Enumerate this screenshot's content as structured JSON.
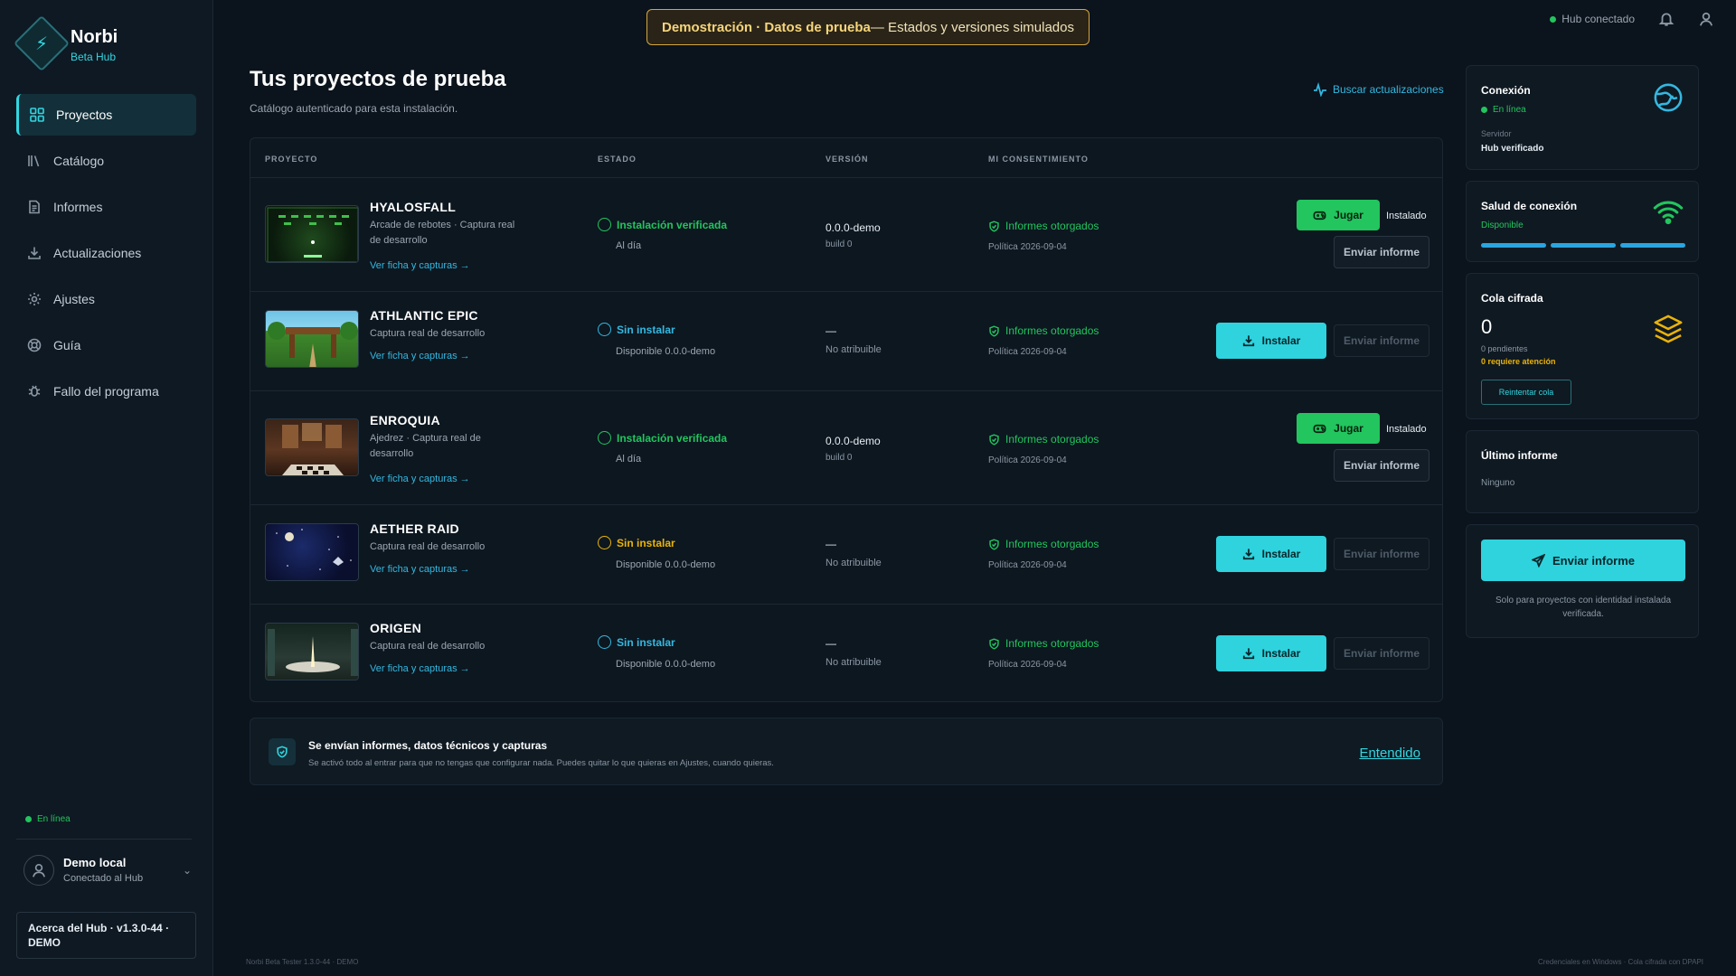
{
  "brand": {
    "name": "Norbi",
    "sub": "Beta Hub"
  },
  "nav": [
    {
      "label": "Proyectos",
      "icon": "grid-icon",
      "active": true
    },
    {
      "label": "Catálogo",
      "icon": "library-icon"
    },
    {
      "label": "Informes",
      "icon": "document-icon"
    },
    {
      "label": "Actualizaciones",
      "icon": "download-icon"
    },
    {
      "label": "Ajustes",
      "icon": "gear-icon"
    },
    {
      "label": "Guía",
      "icon": "lifebuoy-icon"
    },
    {
      "label": "Fallo del programa",
      "icon": "bug-icon"
    }
  ],
  "sidebar_status": "En línea",
  "user": {
    "name": "Demo local",
    "sub": "Conectado al Hub"
  },
  "about": "Acerca del Hub · v1.3.0-44 · DEMO",
  "banner": {
    "bold": "Demostración · Datos de prueba",
    "rest": " — Estados y versiones simulados"
  },
  "topbar": {
    "hub_status": "Hub conectado"
  },
  "page": {
    "title": "Tus proyectos de prueba",
    "subtitle": "Catálogo autenticado para esta instalación.",
    "check_updates": "Buscar actualizaciones"
  },
  "table": {
    "headers": {
      "project": "PROYECTO",
      "state": "ESTADO",
      "version": "VERSIÓN",
      "consent": "MI CONSENTIMIENTO"
    },
    "rows": [
      {
        "name": "HYALOSFALL",
        "desc": "Arcade de rebotes · Captura real de desarrollo",
        "link": "Ver ficha y capturas →",
        "state": "Instalación verificada",
        "state_sub": "Al día",
        "state_color": "#22c55e",
        "version": "0.0.0-demo",
        "version_sub": "build 0",
        "consent": "Informes otorgados",
        "consent_sub": "Política 2026-09-04",
        "installed": true,
        "play": "Jugar",
        "installed_label": "Instalado",
        "report": "Enviar informe"
      },
      {
        "name": "ATHLANTIC EPIC",
        "desc": "Captura real de desarrollo",
        "link": "Ver ficha y capturas →",
        "state": "Sin instalar",
        "state_sub": "Disponible 0.0.0-demo",
        "state_color": "#33b8e0",
        "version": "—",
        "version_sub": "No atribuible",
        "consent": "Informes otorgados",
        "consent_sub": "Política 2026-09-04",
        "installed": false,
        "install": "Instalar",
        "report": "Enviar informe"
      },
      {
        "name": "ENROQUIA",
        "desc": "Ajedrez · Captura real de desarrollo",
        "link": "Ver ficha y capturas →",
        "state": "Instalación verificada",
        "state_sub": "Al día",
        "state_color": "#22c55e",
        "version": "0.0.0-demo",
        "version_sub": "build 0",
        "consent": "Informes otorgados",
        "consent_sub": "Política 2026-09-04",
        "installed": true,
        "play": "Jugar",
        "installed_label": "Instalado",
        "report": "Enviar informe"
      },
      {
        "name": "AETHER RAID",
        "desc": "Captura real de desarrollo",
        "link": "Ver ficha y capturas →",
        "state": "Sin instalar",
        "state_sub": "Disponible 0.0.0-demo",
        "state_color": "#eab308",
        "version": "—",
        "version_sub": "No atribuible",
        "consent": "Informes otorgados",
        "consent_sub": "Política 2026-09-04",
        "installed": false,
        "install": "Instalar",
        "report": "Enviar informe"
      },
      {
        "name": "ORIGEN",
        "desc": "Captura real de desarrollo",
        "link": "Ver ficha y capturas →",
        "state": "Sin instalar",
        "state_sub": "Disponible 0.0.0-demo",
        "state_color": "#33b8e0",
        "version": "—",
        "version_sub": "No atribuible",
        "consent": "Informes otorgados",
        "consent_sub": "Política 2026-09-04",
        "installed": false,
        "install": "Instalar",
        "report": "Enviar informe"
      }
    ]
  },
  "notice": {
    "title": "Se envían informes, datos técnicos y capturas",
    "sub": "Se activó todo al entrar para que no tengas que configurar nada. Puedes quitar lo que quieras en Ajustes, cuando quieras.",
    "ok": "Entendido"
  },
  "cards": {
    "connection": {
      "title": "Conexión",
      "status": "En línea",
      "server_label": "Servidor",
      "server_value": "Hub verificado"
    },
    "health": {
      "title": "Salud de conexión",
      "status": "Disponible",
      "level": 1.0
    },
    "queue": {
      "title": "Cola cifrada",
      "count": "0",
      "pending": "0 pendientes",
      "attention": "0 requiere atención",
      "retry": "Reintentar cola"
    },
    "last": {
      "title": "Último informe",
      "value": "Ninguno"
    },
    "send": {
      "button": "Enviar informe",
      "note": "Solo para proyectos con identidad instalada verificada."
    }
  },
  "footer": {
    "left": "Norbi Beta Tester 1.3.0-44 · DEMO",
    "right": "Credenciales en Windows · Cola cifrada con DPAPI"
  },
  "colors": {
    "accent": "#2ed3de",
    "success": "#22c55e",
    "warning": "#eab308",
    "banner_border": "#d4a53f"
  }
}
